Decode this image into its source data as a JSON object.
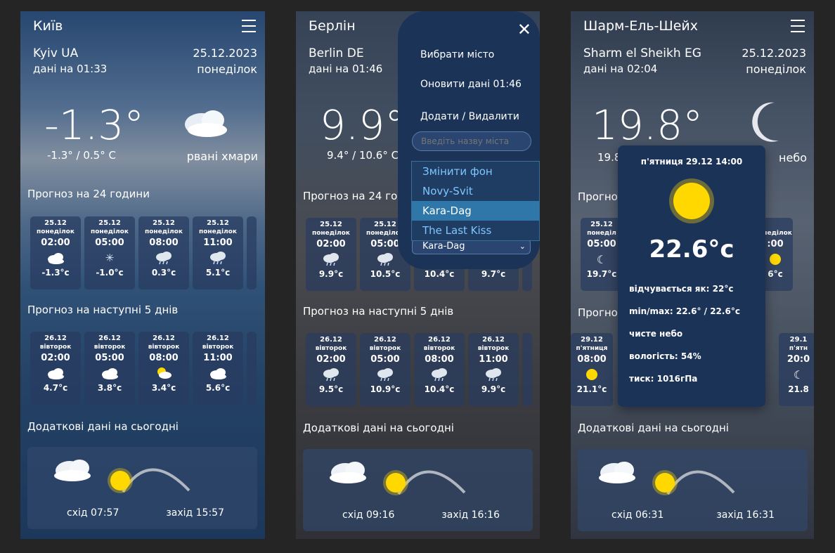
{
  "panel1": {
    "city": "Київ",
    "location": "Kyiv UA",
    "updated": "дані на 01:33",
    "date": "25.12.2023",
    "day": "понеділок",
    "temp": "-1.3°",
    "minmax": "-1.3° / 0.5° C",
    "condition": "рвані хмари",
    "hourly_title": "Прогноз на 24 години",
    "hourly": [
      {
        "date": "25.12",
        "day": "понеділок",
        "time": "02:00",
        "icon": "cloud-icon",
        "temp": "-1.3°c"
      },
      {
        "date": "25.12",
        "day": "понеділок",
        "time": "05:00",
        "icon": "snow-icon",
        "temp": "-1.0°c"
      },
      {
        "date": "25.12",
        "day": "понеділок",
        "time": "08:00",
        "icon": "rain-cloud-icon",
        "temp": "0.3°c"
      },
      {
        "date": "25.12",
        "day": "понеділок",
        "time": "11:00",
        "icon": "rain-cloud-icon",
        "temp": "5.1°c"
      }
    ],
    "daily_title": "Прогноз на наступні 5 днів",
    "daily": [
      {
        "date": "26.12",
        "day": "вівторок",
        "time": "02:00",
        "icon": "cloud-icon",
        "temp": "4.7°c"
      },
      {
        "date": "26.12",
        "day": "вівторок",
        "time": "05:00",
        "icon": "cloud-icon",
        "temp": "3.8°c"
      },
      {
        "date": "26.12",
        "day": "вівторок",
        "time": "08:00",
        "icon": "sun-cloud-icon",
        "temp": "3.4°c"
      },
      {
        "date": "26.12",
        "day": "вівторок",
        "time": "11:00",
        "icon": "cloud-icon",
        "temp": "5.6°c"
      }
    ],
    "extra_title": "Додаткові дані на сьогодні",
    "sunrise": "схід 07:57",
    "sunset": "захід 15:57"
  },
  "panel2": {
    "city": "Берлін",
    "location": "Berlin DE",
    "updated": "дані на 01:46",
    "temp": "9.9°",
    "minmax": "9.4° / 10.6° C",
    "hourly_title": "Прогноз на 24 години",
    "hourly": [
      {
        "date": "25.12",
        "day": "понеділок",
        "time": "02:00",
        "icon": "rain-cloud-icon",
        "temp": "9.9°c"
      },
      {
        "date": "25.12",
        "day": "понеділок",
        "time": "05:00",
        "icon": "rain-cloud-icon",
        "temp": "10.5°c"
      },
      {
        "date": "25.12",
        "day": "понеділок",
        "time": "08:00",
        "icon": "rain-cloud-icon",
        "temp": "10.4°c"
      },
      {
        "date": "25.12",
        "day": "понеділок",
        "time": "11:00",
        "icon": "rain-cloud-icon",
        "temp": "9.7°c"
      }
    ],
    "daily_title": "Прогноз на наступні 5 днів",
    "daily": [
      {
        "date": "26.12",
        "day": "вівторок",
        "time": "02:00",
        "icon": "rain-cloud-icon",
        "temp": "9.5°c"
      },
      {
        "date": "26.12",
        "day": "вівторок",
        "time": "05:00",
        "icon": "rain-cloud-icon",
        "temp": "10.9°c"
      },
      {
        "date": "26.12",
        "day": "вівторок",
        "time": "08:00",
        "icon": "rain-cloud-icon",
        "temp": "10.4°c"
      },
      {
        "date": "26.12",
        "day": "вівторок",
        "time": "11:00",
        "icon": "rain-cloud-icon",
        "temp": "9.9°c"
      }
    ],
    "extra_title": "Додаткові дані на сьогодні",
    "sunrise": "схід 09:16",
    "sunset": "захід 16:16",
    "menu": {
      "choose_city": "Вибрати місто",
      "refresh": "Оновити дані 01:46",
      "add_remove": "Додати / Видалити",
      "search_placeholder": "Введіть назву міста",
      "dropdown": [
        "Змінити фон",
        "Novy-Svit",
        "Kara-Dag",
        "The Last Kiss"
      ],
      "selected": "Kara-Dag"
    }
  },
  "panel3": {
    "city": "Шарм-Ель-Шейх",
    "location": "Sharm el Sheikh EG",
    "updated": "дані на 02:04",
    "date": "25.12.2023",
    "day": "понеділок",
    "temp": "19.8°",
    "minmax_partial": "19.8",
    "cond_partial": "небо",
    "hourly_title_partial": "Прогно",
    "daily_title_partial": "Прогно",
    "extra_title": "Додаткові дані на сьогодні",
    "sunrise": "схід 06:31",
    "sunset": "захід 16:31",
    "left_cards": [
      {
        "date": "25.12",
        "day": "понеділ",
        "time": "05:00",
        "icon": "moon-icon",
        "temp": "19.7°c"
      },
      {
        "date": "29.12",
        "day": "п'ятниця",
        "time": "08:00",
        "icon": "sun-icon",
        "temp": "21.1°c"
      }
    ],
    "right_cards": [
      {
        "day": "онеділок",
        "time": ":00",
        "icon": "sun-icon",
        "temp": "6°c"
      },
      {
        "date": "29.1",
        "day": "п'ятн",
        "time": "20:0",
        "icon": "moon-icon",
        "temp": "21.8"
      }
    ],
    "popup": {
      "title": "п'ятниця 29.12 14:00",
      "temp": "22.6°c",
      "feels": "відчувається як: 22°c",
      "minmax": "min/max: 22.6° / 22.6°c",
      "cond": "чисте небо",
      "humidity": "вологість: 54%",
      "pressure": "тиск: 1016гПа"
    }
  },
  "colors": {
    "page_bg": "#252526",
    "menu_bg": "#1c3358",
    "sun": "#ffd800",
    "highlight": "#2e77a8",
    "link": "#7fc6ff"
  }
}
